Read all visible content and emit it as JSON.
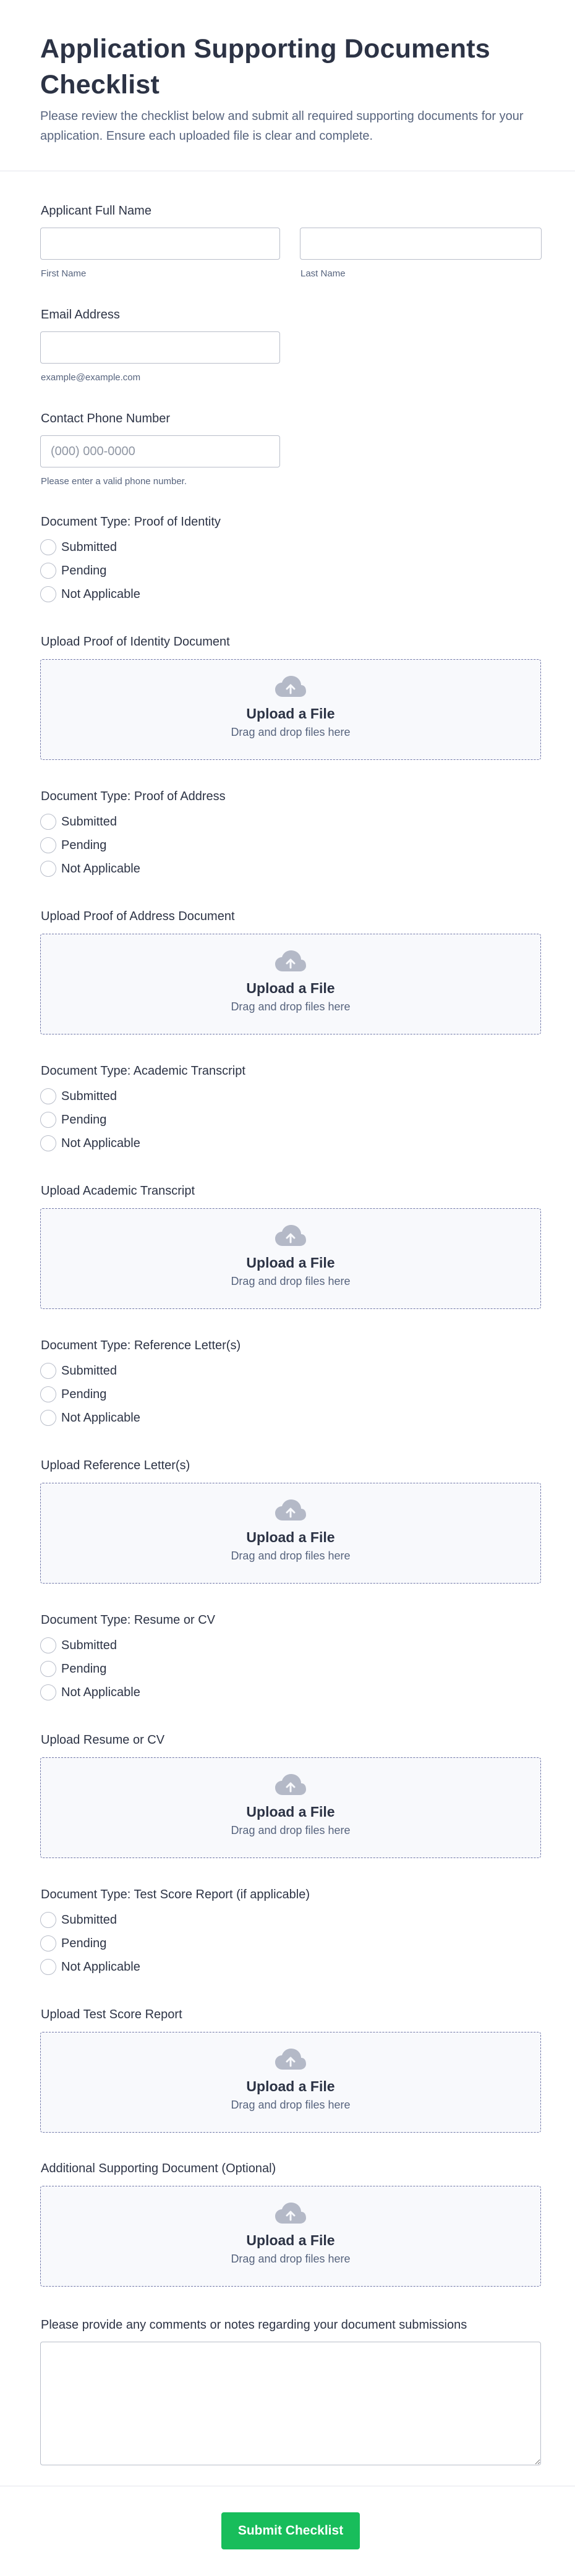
{
  "header": {
    "title": "Application Supporting Documents Checklist",
    "description": "Please review the checklist below and submit all required supporting documents for your application. Ensure each uploaded file is clear and complete."
  },
  "full_name": {
    "label": "Applicant Full Name",
    "first_sublabel": "First Name",
    "last_sublabel": "Last Name"
  },
  "email": {
    "label": "Email Address",
    "sublabel": "example@example.com"
  },
  "phone": {
    "label": "Contact Phone Number",
    "placeholder": "(000) 000-0000",
    "sublabel": "Please enter a valid phone number."
  },
  "radio_options": [
    "Submitted",
    "Pending",
    "Not Applicable"
  ],
  "upload": {
    "title": "Upload a File",
    "subtitle": "Drag and drop files here"
  },
  "documents": [
    {
      "type_label": "Document Type: Proof of Identity",
      "upload_label": "Upload Proof of Identity Document"
    },
    {
      "type_label": "Document Type: Proof of Address",
      "upload_label": "Upload Proof of Address Document"
    },
    {
      "type_label": "Document Type: Academic Transcript",
      "upload_label": "Upload Academic Transcript"
    },
    {
      "type_label": "Document Type: Reference Letter(s)",
      "upload_label": "Upload Reference Letter(s)"
    },
    {
      "type_label": "Document Type: Resume or CV",
      "upload_label": "Upload Resume or CV"
    },
    {
      "type_label": "Document Type: Test Score Report (if applicable)",
      "upload_label": "Upload Test Score Report"
    }
  ],
  "additional": {
    "label": "Additional Supporting Document (Optional)"
  },
  "comments": {
    "label": "Please provide any comments or notes regarding your document submissions"
  },
  "submit": {
    "label": "Submit Checklist"
  }
}
